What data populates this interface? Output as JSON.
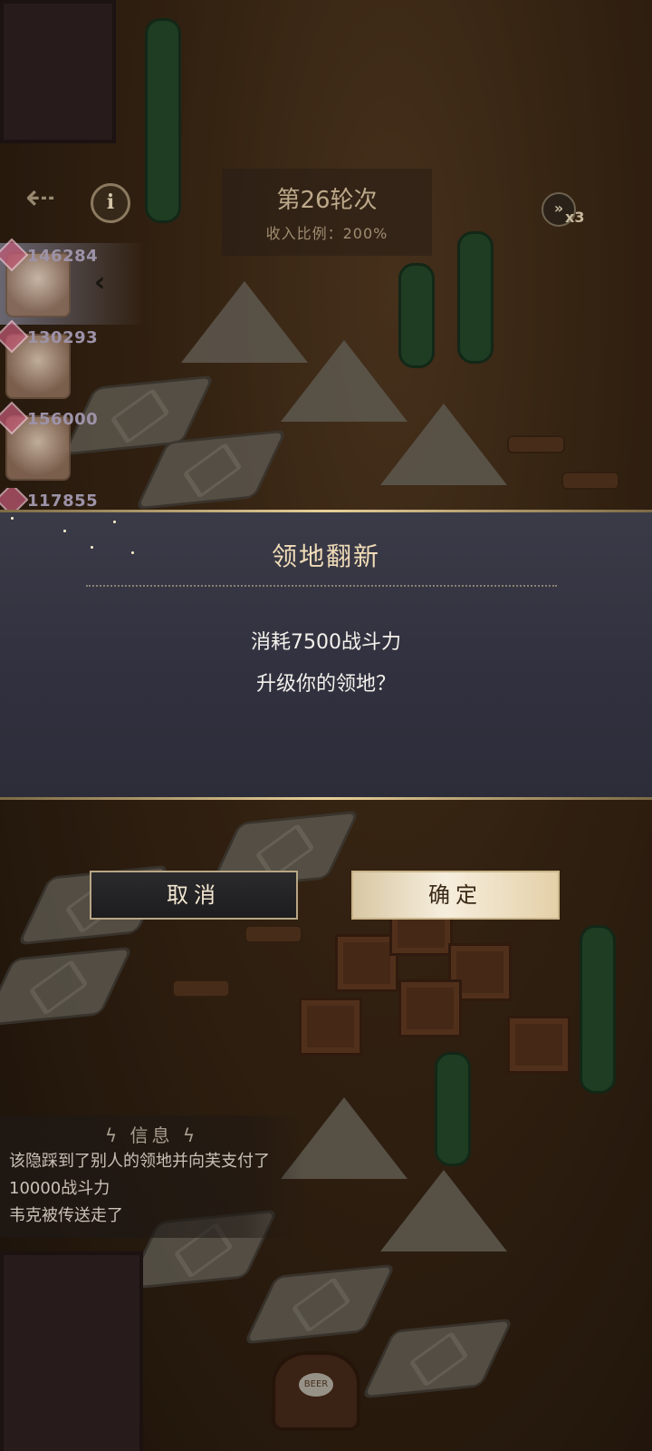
{
  "hud": {
    "back_icon": "back-arrow-icon",
    "info_label": "i",
    "round_title": "第26轮次",
    "income_ratio": "收入比例：200%",
    "speed_icon": "fast-forward-icon",
    "speed_multiplier": "x3"
  },
  "players": [
    {
      "score": "146284",
      "active": true
    },
    {
      "score": "130293",
      "active": false
    },
    {
      "score": "156000",
      "active": false
    },
    {
      "score": "117855",
      "active": false
    }
  ],
  "collapse_icon": "chevron-left-icon",
  "modal": {
    "title": "领地翻新",
    "line1": "消耗7500战斗力",
    "line2": "升级你的领地？"
  },
  "buttons": {
    "cancel": "取消",
    "confirm": "确定"
  },
  "log": {
    "title": "信息",
    "lines": [
      "该隐踩到了别人的领地并向芙支付了",
      "10000战斗力",
      "韦克被传送走了"
    ]
  },
  "colors": {
    "modal_bg": "#33333f",
    "title_gold": "#f0dcb7",
    "confirm_bg": "#f0e4cb"
  }
}
